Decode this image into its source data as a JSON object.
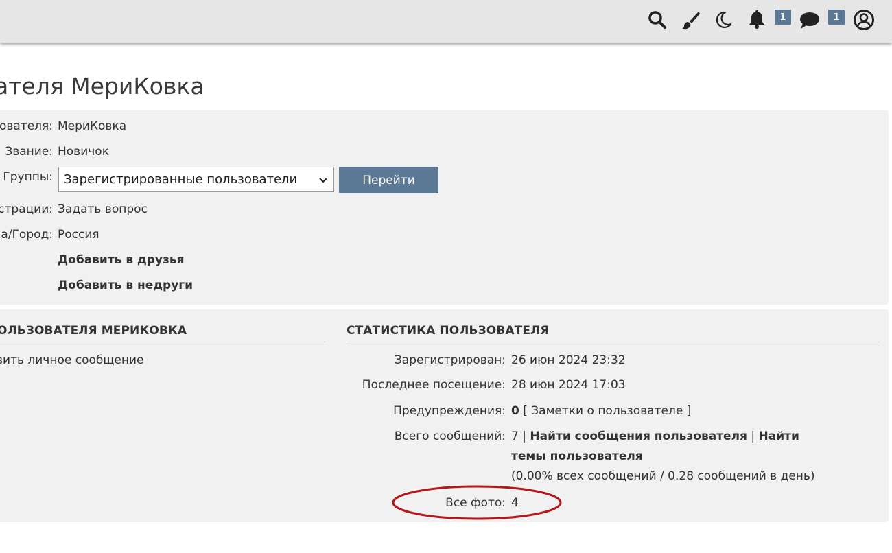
{
  "topbar": {
    "icons": [
      "search-icon",
      "brush-icon",
      "moon-icon",
      "bell-icon",
      "chat-icon",
      "user-circle-icon"
    ],
    "notifications_count": "1",
    "messages_count": "1"
  },
  "page": {
    "title": "ателя МериКовка"
  },
  "profile": {
    "username_label": "ователя:",
    "username_value": "МериКовка",
    "rank_label": "Звание:",
    "rank_value": "Новичок",
    "groups_label": "Группы:",
    "groups_selected": "Зарегистрированные пользователи",
    "go_button": "Перейти",
    "reg_label": "страции:",
    "reg_value": "Задать вопрос",
    "city_label": "а/Город:",
    "city_value": "Россия",
    "add_friend": "Добавить в друзья",
    "add_foe": "Добавить в недруги"
  },
  "contact": {
    "title": "ОЛЬЗОВАТЕЛЯ МЕРИКОВКА",
    "send_pm": "вить личное сообщение"
  },
  "stats": {
    "title": "СТАТИСТИКА ПОЛЬЗОВАТЕЛЯ",
    "registered_label": "Зарегистрирован:",
    "registered_value": "26 июн 2024 23:32",
    "last_visit_label": "Последнее посещение:",
    "last_visit_value": "28 июн 2024 17:03",
    "warnings_label": "Предупреждения:",
    "warnings_value": "0",
    "notes_link": "[ Заметки о пользователе ]",
    "posts_label": "Всего сообщений:",
    "posts_value": "7",
    "sep": "|",
    "find_posts": "Найти сообщения пользователя",
    "find_topics_1": "Найти",
    "find_topics_2": "темы пользователя",
    "posts_ratio": "(0.00% всех сообщений / 0.28 сообщений в день)",
    "photos_label": "Все фото:",
    "photos_value": "4"
  },
  "colors": {
    "topbar_bg": "#e6e6e6",
    "panel_bg": "#f1f1f1",
    "accent": "#5b7895",
    "annotation": "#b5171b"
  }
}
